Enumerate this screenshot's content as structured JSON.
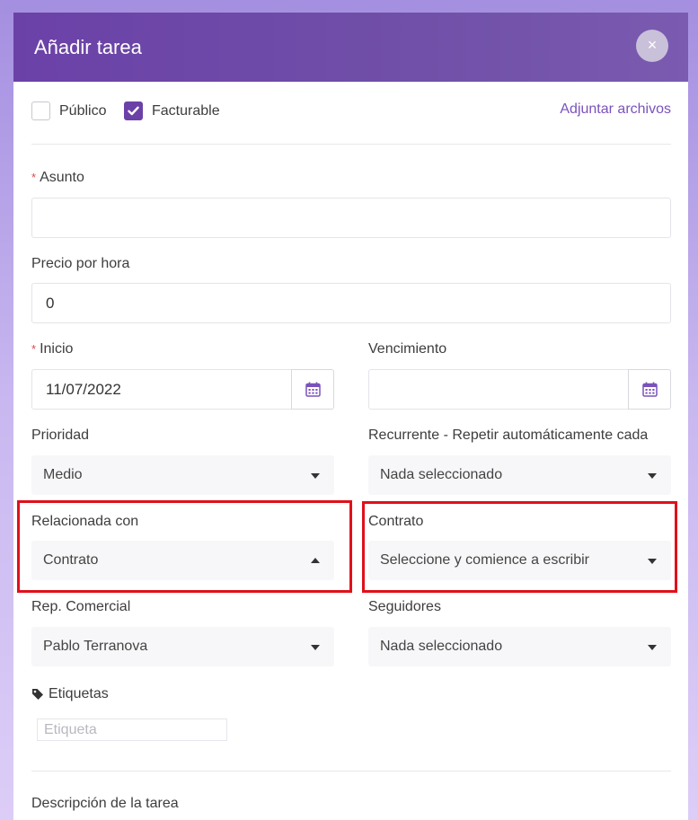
{
  "modal": {
    "title": "Añadir tarea",
    "close_glyph": "×"
  },
  "checks": {
    "public_label": "Público",
    "public_checked": false,
    "billable_label": "Facturable",
    "billable_checked": true,
    "attach_label": "Adjuntar archivos"
  },
  "fields": {
    "subject_label": "Asunto",
    "subject_value": "",
    "hourly_label": "Precio por hora",
    "hourly_value": "0",
    "start_label": "Inicio",
    "start_value": "11/07/2022",
    "due_label": "Vencimiento",
    "due_value": "",
    "priority_label": "Prioridad",
    "priority_value": "Medio",
    "recurring_label": "Recurrente - Repetir automáticamente cada",
    "recurring_value": "Nada seleccionado",
    "related_label": "Relacionada con",
    "related_value": "Contrato",
    "contract_label": "Contrato",
    "contract_value": "Seleccione y comience a escribir",
    "sales_label": "Rep. Comercial",
    "sales_value": "Pablo Terranova",
    "followers_label": "Seguidores",
    "followers_value": "Nada seleccionado",
    "tags_label": "Etiquetas",
    "tags_placeholder": "Etiqueta",
    "description_label": "Descripción de la tarea"
  },
  "required_mark": "*",
  "colors": {
    "header": "#6b41a8",
    "accent": "#7a52bd",
    "highlight": "#e0101a",
    "required": "#e04848"
  },
  "icons": [
    "close-icon",
    "check-icon",
    "calendar-icon",
    "caret-down-icon",
    "caret-up-icon",
    "tag-icon"
  ]
}
